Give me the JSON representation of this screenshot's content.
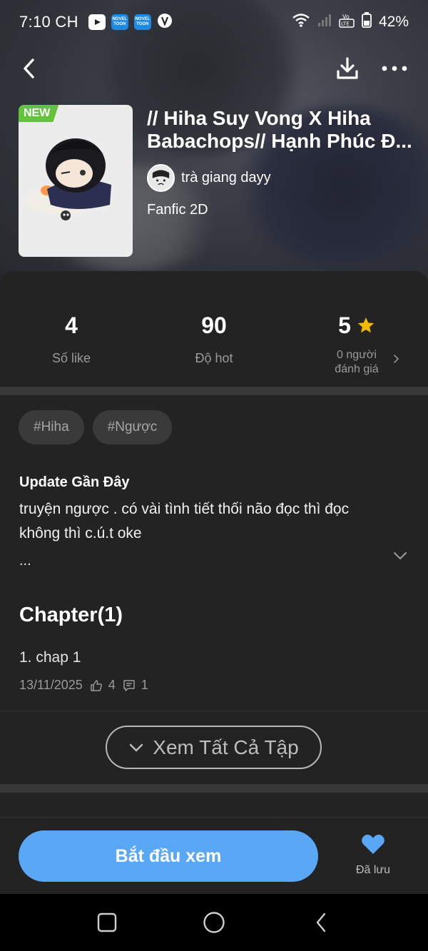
{
  "status_bar": {
    "time": "7:10 CH",
    "battery": "42%",
    "network_label": "Vo LTE"
  },
  "nav": {
    "back": "back",
    "download": "download",
    "more": "more"
  },
  "story": {
    "badge": "NEW",
    "title": "// Hiha Suy Vong X Hiha Babachops// Hạnh Phúc Đ...",
    "author": "trà giang dayy",
    "genre": "Fanfic 2D"
  },
  "stats": {
    "likes_value": "4",
    "likes_label": "Số like",
    "hot_value": "90",
    "hot_label": "Độ hot",
    "rating_value": "5",
    "rating_label_line1": "0 người",
    "rating_label_line2": "đánh giá"
  },
  "tags": [
    "#Hiha",
    "#Ngược"
  ],
  "update": {
    "title": "Update Gần Đây",
    "body": "truyện ngược . có vài tình tiết thối não đọc thì đọc không thì c.ú.t oke",
    "ellipsis": "..."
  },
  "chapters": {
    "heading": "Chapter(1)",
    "items": [
      {
        "name": "1. chap 1",
        "date": "13/11/2025",
        "likes": "4",
        "comments": "1"
      }
    ],
    "view_all": "Xem Tất Cả Tập"
  },
  "actions": {
    "start": "Bắt đầu xem",
    "saved": "Đã lưu"
  },
  "colors": {
    "accent": "#5aa7f5",
    "badge_green": "#62c43b",
    "star": "#f5b800",
    "sheet_bg": "#232323"
  }
}
